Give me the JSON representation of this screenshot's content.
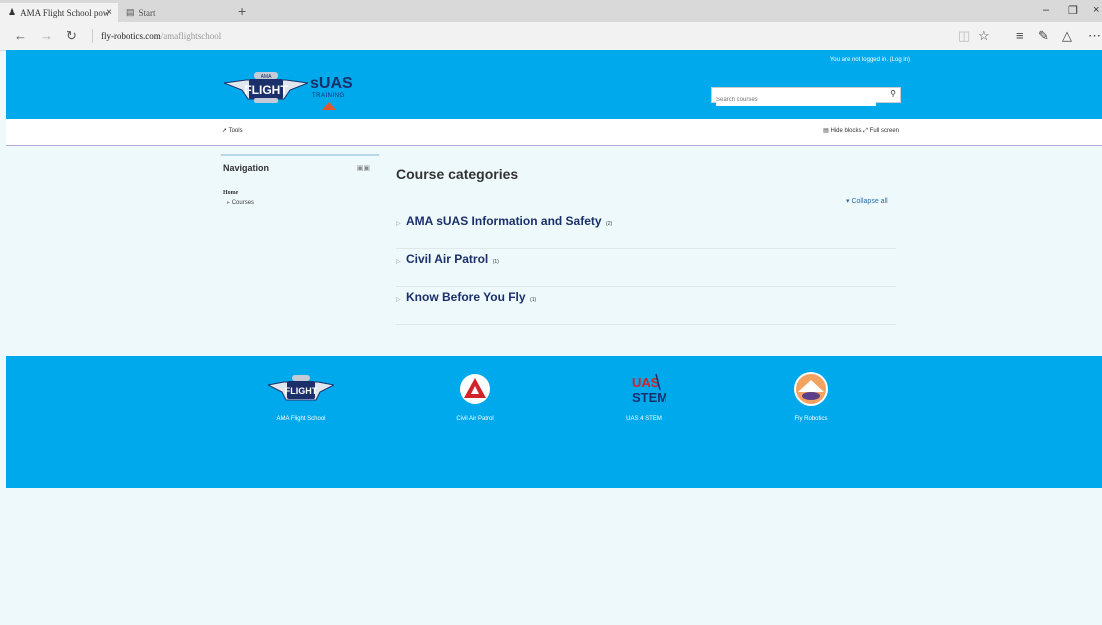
{
  "browser": {
    "tabs": [
      {
        "label": "AMA Flight School pow",
        "active": true
      },
      {
        "label": "Start",
        "active": false
      }
    ],
    "url_host": "fly-robotics.com",
    "url_path": "/amaflightschool"
  },
  "header": {
    "login_text": "You are not logged in. (Log in)",
    "logo_suas": "sUAS",
    "logo_sub": "TRAINING",
    "search_placeholder": "Search courses"
  },
  "navbar": {
    "tools_label": "Tools",
    "hide_blocks_label": "Hide blocks",
    "full_screen_label": "Full screen"
  },
  "navigation_block": {
    "title": "Navigation",
    "home": "Home",
    "courses": "Courses"
  },
  "main": {
    "title": "Course categories",
    "collapse_all": "Collapse all",
    "categories": [
      {
        "name": "AMA sUAS Information and Safety",
        "count": "(2)"
      },
      {
        "name": "Civil Air Patrol",
        "count": "(1)"
      },
      {
        "name": "Know Before You Fly",
        "count": "(1)"
      }
    ]
  },
  "footer": {
    "links": [
      "AMA Flight School",
      "Civil Air Patrol",
      "UAS 4 STEM",
      "Fly Robotics"
    ]
  },
  "colors": {
    "brand_blue": "#00a8ec",
    "navy": "#1b2f6a"
  }
}
